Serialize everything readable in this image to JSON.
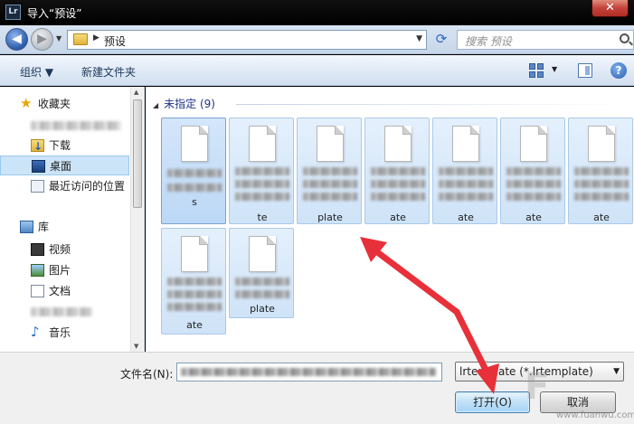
{
  "window": {
    "app_icon": "Lr",
    "title": "导入“预设”",
    "close_glyph": "✕"
  },
  "nav": {
    "back_glyph": "◀",
    "forward_glyph": "▶",
    "path": "预设",
    "search_placeholder": "搜索 预设"
  },
  "toolbar": {
    "organize": "组织 ▼",
    "new_folder": "新建文件夹",
    "view_dropdown": "▼",
    "help": "?"
  },
  "sidebar": {
    "favorites": "收藏夹",
    "downloads": "下载",
    "desktop": "桌面",
    "recent": "最近访问的位置",
    "libraries": "库",
    "videos": "视频",
    "pictures": "图片",
    "documents": "文档",
    "music": "音乐"
  },
  "files": {
    "group_header": "未指定 (9)",
    "items": [
      {
        "label_tail": "s"
      },
      {
        "label_tail": "te"
      },
      {
        "label_tail": "plate"
      },
      {
        "label_tail": "ate"
      },
      {
        "label_tail": "ate"
      },
      {
        "label_tail": "ate"
      },
      {
        "label_tail": "ate"
      },
      {
        "label_tail": "ate"
      },
      {
        "label_tail": "plate"
      }
    ]
  },
  "footer": {
    "filename_label": "文件名(N):",
    "filter_text": "lrtemplate (*.lrtemplate)",
    "open_button": "打开(O)",
    "cancel_button": "取消"
  },
  "watermark": {
    "url": "www.fuanwu.com"
  },
  "colors": {
    "annotation_arrow": "#e8303a",
    "selection": "#cce4f7"
  }
}
